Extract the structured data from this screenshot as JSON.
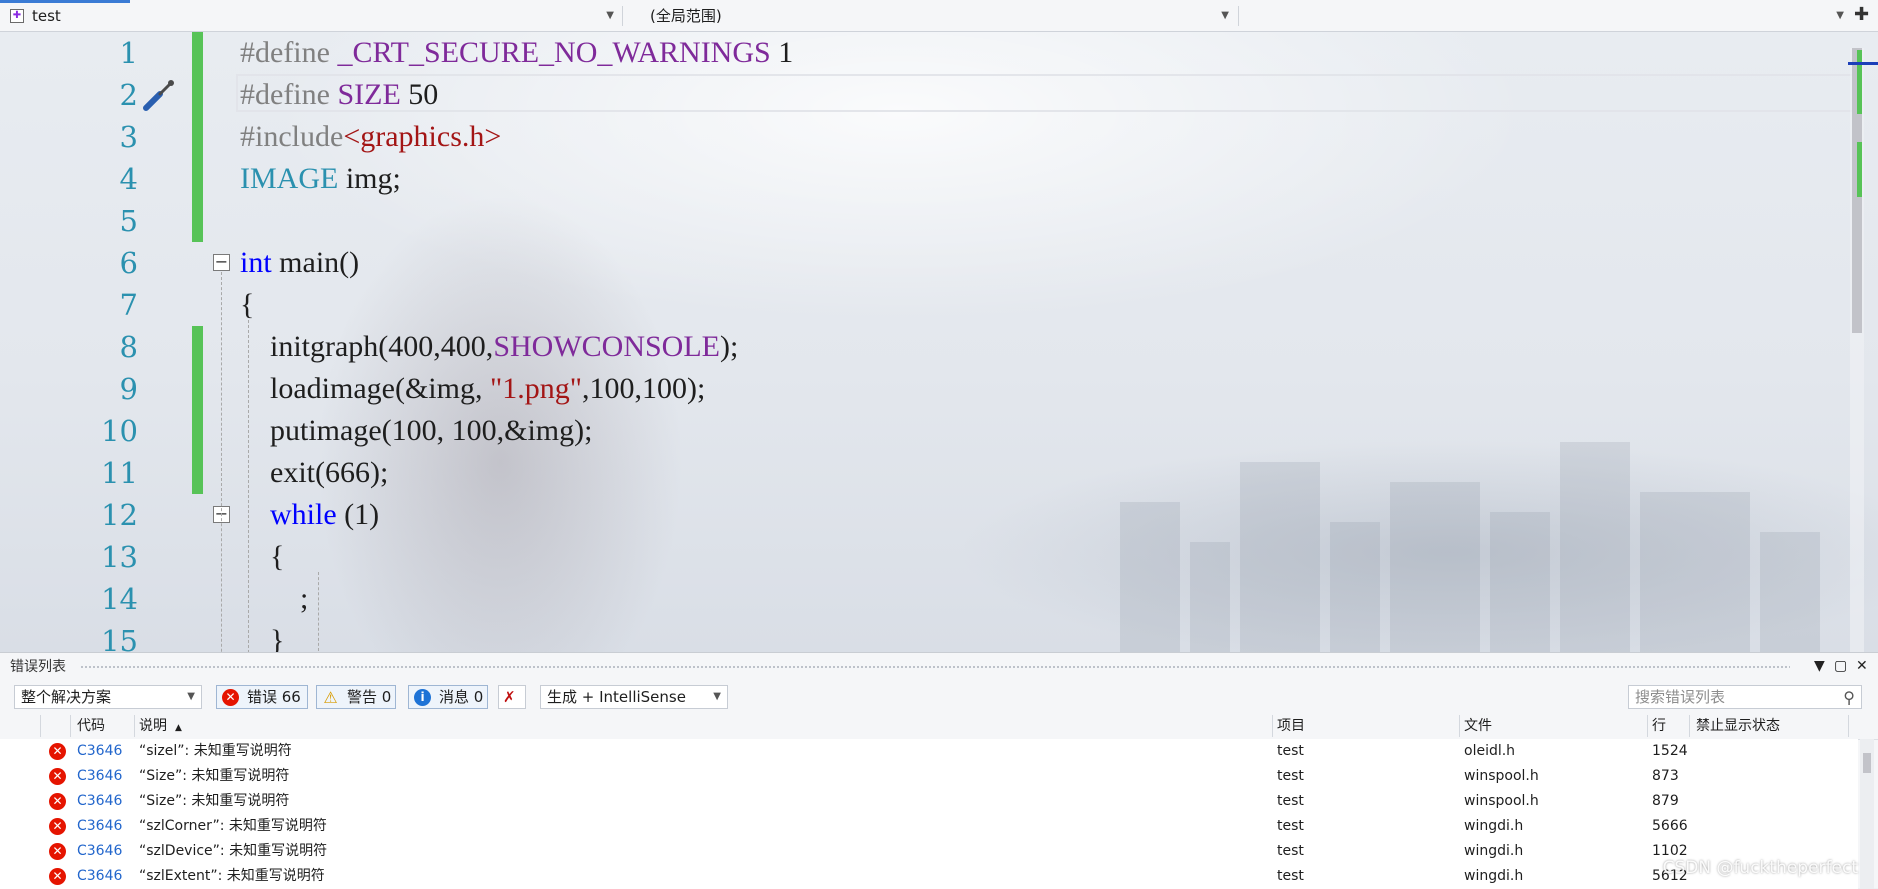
{
  "navbar": {
    "project": "test",
    "scope": "(全局范围)",
    "member": "",
    "split_icon": "split-window-icon"
  },
  "editor": {
    "lines": [
      {
        "n": "1",
        "tokens": [
          {
            "t": "#define ",
            "c": "pre"
          },
          {
            "t": "_CRT_SECURE_NO_WARNINGS",
            "c": "macro"
          },
          {
            "t": " 1",
            "c": "txt"
          }
        ]
      },
      {
        "n": "2",
        "tokens": [
          {
            "t": "#define ",
            "c": "pre"
          },
          {
            "t": "SIZE",
            "c": "macro"
          },
          {
            "t": " 50",
            "c": "txt"
          }
        ]
      },
      {
        "n": "3",
        "tokens": [
          {
            "t": "#include",
            "c": "pre"
          },
          {
            "t": "<graphics.h>",
            "c": "str"
          }
        ]
      },
      {
        "n": "4",
        "tokens": [
          {
            "t": "IMAGE",
            "c": "type"
          },
          {
            "t": " img;",
            "c": "txt"
          }
        ]
      },
      {
        "n": "5",
        "tokens": []
      },
      {
        "n": "6",
        "tokens": [
          {
            "t": "int",
            "c": "kw"
          },
          {
            "t": " main()",
            "c": "txt"
          }
        ]
      },
      {
        "n": "7",
        "tokens": [
          {
            "t": "{",
            "c": "txt"
          }
        ]
      },
      {
        "n": "8",
        "tokens": [
          {
            "t": "    initgraph(400,400,",
            "c": "txt"
          },
          {
            "t": "SHOWCONSOLE",
            "c": "macro"
          },
          {
            "t": ");",
            "c": "txt"
          }
        ]
      },
      {
        "n": "9",
        "tokens": [
          {
            "t": "    loadimage(&img, ",
            "c": "txt"
          },
          {
            "t": "\"1.png\"",
            "c": "str"
          },
          {
            "t": ",100,100);",
            "c": "txt"
          }
        ]
      },
      {
        "n": "10",
        "tokens": [
          {
            "t": "    putimage(100, 100,&img);",
            "c": "txt"
          }
        ]
      },
      {
        "n": "11",
        "tokens": [
          {
            "t": "    exit(666);",
            "c": "txt"
          }
        ]
      },
      {
        "n": "12",
        "tokens": [
          {
            "t": "    ",
            "c": "txt"
          },
          {
            "t": "while",
            "c": "kw"
          },
          {
            "t": " (1)",
            "c": "txt"
          }
        ]
      },
      {
        "n": "13",
        "tokens": [
          {
            "t": "    {",
            "c": "txt"
          }
        ]
      },
      {
        "n": "14",
        "tokens": [
          {
            "t": "        ;",
            "c": "txt"
          }
        ]
      },
      {
        "n": "15",
        "tokens": [
          {
            "t": "    }",
            "c": "txt"
          }
        ]
      }
    ],
    "modified_lines": [
      1,
      2,
      3,
      4,
      5,
      8,
      9,
      10,
      11
    ],
    "fold_lines": [
      6,
      12
    ],
    "colors": {
      "pre": "#808080",
      "macro": "#7f2a9a",
      "str": "#a31515",
      "kw": "#0000ff",
      "type": "#2b91af",
      "line_number": "#2b91af",
      "change_bar": "#57c357"
    }
  },
  "error_list": {
    "title": "错误列表",
    "scope_select": "整个解决方案",
    "errors_btn": "错误 66",
    "warnings_btn": "警告 0",
    "messages_btn": "消息 0",
    "build_select": "生成 + IntelliSense",
    "search_placeholder": "搜索错误列表",
    "columns": {
      "code": "代码",
      "desc": "说明",
      "project": "项目",
      "file": "文件",
      "line": "行",
      "suppress": "禁止显示状态"
    },
    "rows": [
      {
        "code": "C3646",
        "desc": "“sizel”: 未知重写说明符",
        "project": "test",
        "file": "oleidl.h",
        "line": "1524"
      },
      {
        "code": "C3646",
        "desc": "“Size”: 未知重写说明符",
        "project": "test",
        "file": "winspool.h",
        "line": "873"
      },
      {
        "code": "C3646",
        "desc": "“Size”: 未知重写说明符",
        "project": "test",
        "file": "winspool.h",
        "line": "879"
      },
      {
        "code": "C3646",
        "desc": "“szlCorner”: 未知重写说明符",
        "project": "test",
        "file": "wingdi.h",
        "line": "5666"
      },
      {
        "code": "C3646",
        "desc": "“szlDevice”: 未知重写说明符",
        "project": "test",
        "file": "wingdi.h",
        "line": "1102"
      },
      {
        "code": "C3646",
        "desc": "“szlExtent”: 未知重写说明符",
        "project": "test",
        "file": "wingdi.h",
        "line": "5612"
      }
    ]
  },
  "watermark": "CSDN @fucktheperfect"
}
